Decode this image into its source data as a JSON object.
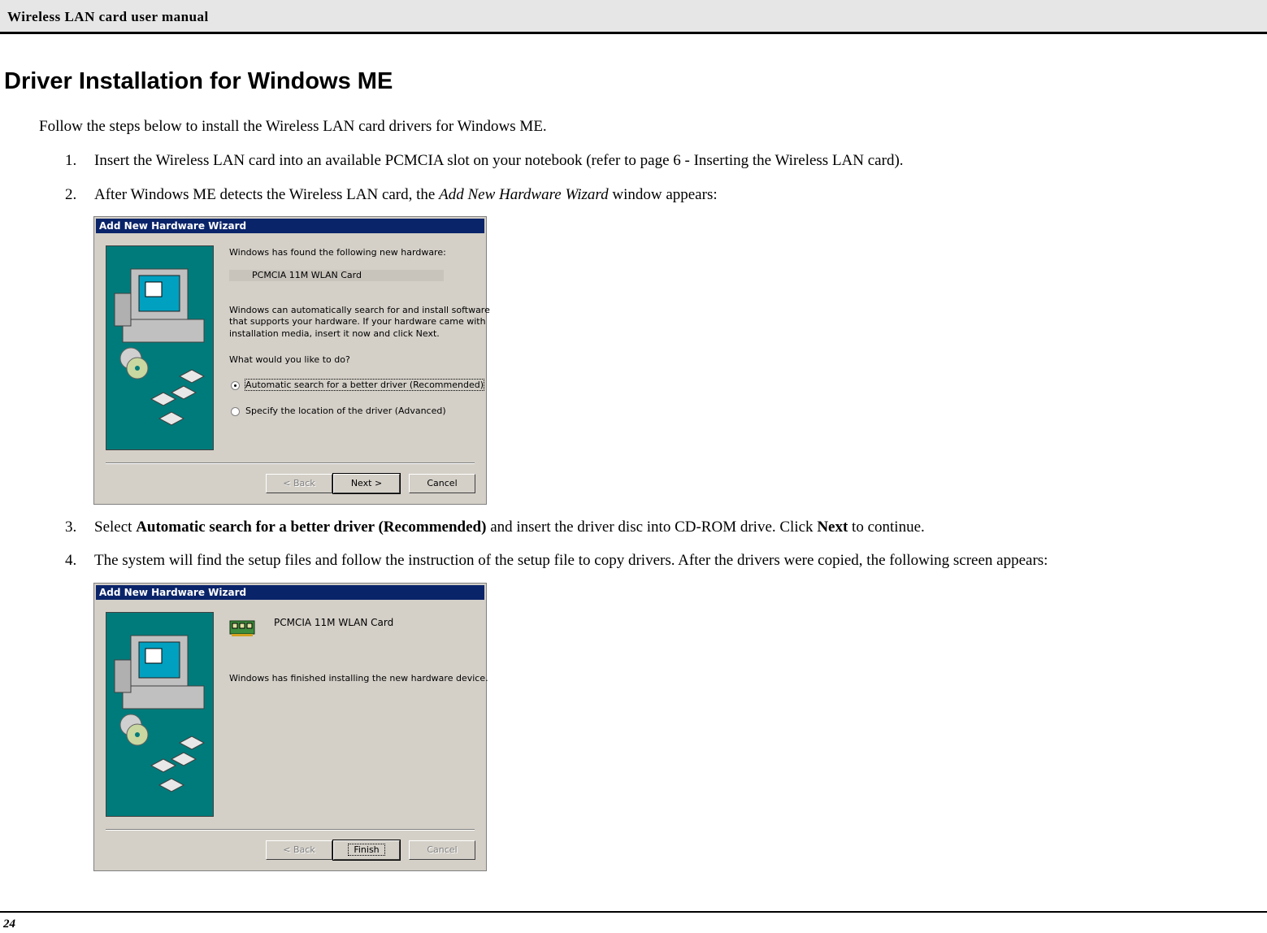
{
  "header": {
    "title": "Wireless LAN card user manual"
  },
  "heading": "Driver Installation for Windows ME",
  "intro": "Follow the steps below to install the Wireless LAN card drivers for Windows ME.",
  "steps": [
    {
      "num": "1.",
      "text": "Insert the Wireless LAN card into an available PCMCIA slot on your notebook (refer to page 6  - Inserting the Wireless LAN card)."
    },
    {
      "num": "2.",
      "pre": "After Windows ME detects the Wireless LAN card, the ",
      "em": "Add New Hardware Wizard",
      "post": " window appears:"
    },
    {
      "num": "3.",
      "pre": "Select ",
      "b1": "Automatic search for a better driver (Recommended)",
      "mid": " and insert the driver disc into CD-ROM drive. Click ",
      "b2": "Next",
      "post": " to continue."
    },
    {
      "num": "4.",
      "text": "The system will find the setup files and follow the instruction of the setup file to copy drivers. After the drivers were copied, the following screen appears:"
    }
  ],
  "dialog1": {
    "title": "Add New Hardware Wizard",
    "found": "Windows has found the following new hardware:",
    "device": "PCMCIA 11M WLAN Card",
    "desc1": "Windows can automatically search for and install software",
    "desc2": "that supports your hardware. If your hardware came with",
    "desc3": "installation media, insert it now and click Next.",
    "question": "What would you like to do?",
    "option_auto": "Automatic search for a better driver (Recommended)",
    "option_specify": "Specify the location of the driver (Advanced)",
    "back": "< Back",
    "next": "Next >",
    "cancel": "Cancel"
  },
  "dialog2": {
    "title": "Add New Hardware Wizard",
    "device": "PCMCIA 11M WLAN Card",
    "finished": "Windows has finished installing the new hardware device.",
    "back": "< Back",
    "finish": "Finish",
    "cancel": "Cancel"
  },
  "footer": {
    "page_number": "24"
  }
}
